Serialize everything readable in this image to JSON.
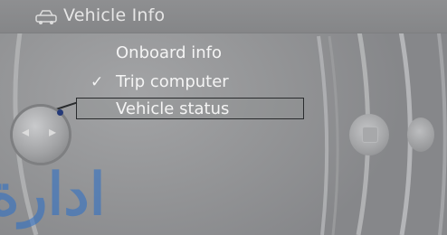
{
  "header": {
    "title": "Vehicle Info",
    "icon": "car-icon"
  },
  "menu": {
    "items": [
      {
        "label": "Onboard info",
        "checked": false,
        "selected": false
      },
      {
        "label": "Trip computer",
        "checked": true,
        "selected": false
      },
      {
        "label": "Vehicle status",
        "checked": false,
        "selected": true
      }
    ],
    "checkmark": "✓"
  },
  "controller": {
    "left_arrow": "◂",
    "right_arrow": "▸"
  },
  "watermark": {
    "text": "ادارة"
  },
  "colors": {
    "background": "#939496",
    "text": "#f4f4f4",
    "selection_border": "#2a2c2e",
    "watermark": "#286ec8"
  }
}
